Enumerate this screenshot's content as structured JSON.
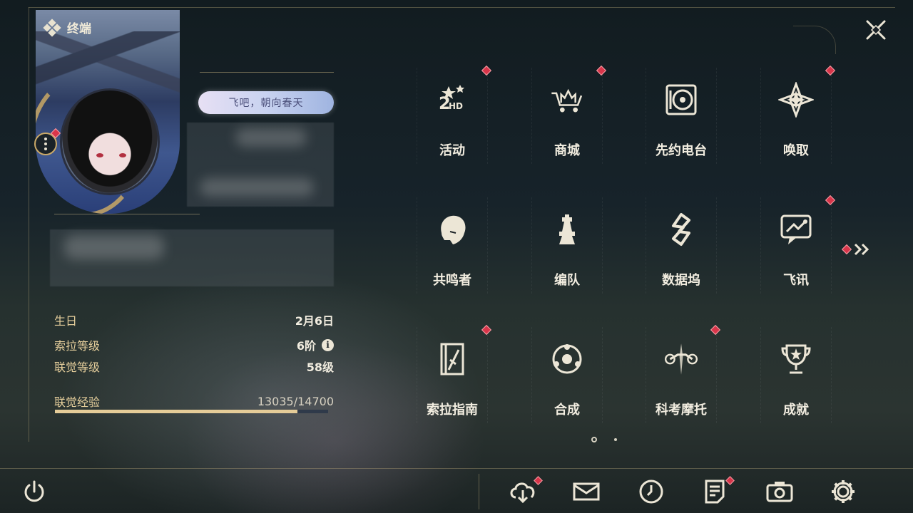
{
  "header": {
    "title": "终端"
  },
  "profile": {
    "signature": "飞吧，朝向春天",
    "stats": [
      {
        "label": "生日",
        "value": "2月6日"
      },
      {
        "label": "索拉等级",
        "value": "6阶"
      },
      {
        "label": "联觉等级",
        "value": "58级"
      }
    ],
    "exp": {
      "label": "联觉经验",
      "value": "13035/14700",
      "progress": 0.887
    }
  },
  "menu": {
    "items": [
      {
        "label": "活动",
        "icon": "event-2hd-icon",
        "badge": true
      },
      {
        "label": "商城",
        "icon": "shop-cart-crown-icon",
        "badge": true
      },
      {
        "label": "先约电台",
        "icon": "radio-record-icon",
        "badge": false
      },
      {
        "label": "唤取",
        "icon": "convene-compass-icon",
        "badge": true
      },
      {
        "label": "共鸣者",
        "icon": "resonator-head-icon",
        "badge": false
      },
      {
        "label": "编队",
        "icon": "team-chess-icon",
        "badge": false
      },
      {
        "label": "数据坞",
        "icon": "data-bank-icon",
        "badge": false
      },
      {
        "label": "飞讯",
        "icon": "message-chat-icon",
        "badge": true
      },
      {
        "label": "索拉指南",
        "icon": "guidebook-icon",
        "badge": true
      },
      {
        "label": "合成",
        "icon": "synthesis-icon",
        "badge": false
      },
      {
        "label": "科考摩托",
        "icon": "motorcycle-icon",
        "badge": true
      },
      {
        "label": "成就",
        "icon": "trophy-icon",
        "badge": false
      }
    ],
    "page_indicator": {
      "current": 1,
      "total": 2
    }
  },
  "bottom_bar": {
    "items": [
      {
        "name": "download",
        "icon": "cloud-download-icon",
        "badge": true
      },
      {
        "name": "mail",
        "icon": "mail-icon",
        "badge": false
      },
      {
        "name": "time",
        "icon": "clock-icon",
        "badge": false
      },
      {
        "name": "notice",
        "icon": "notice-icon",
        "badge": true
      },
      {
        "name": "photo",
        "icon": "camera-icon",
        "badge": false
      },
      {
        "name": "settings",
        "icon": "gear-icon",
        "badge": false
      }
    ]
  },
  "colors": {
    "accent_gold": "#e5cc98",
    "badge_red": "#d9354a",
    "text": "#f2ede0"
  }
}
